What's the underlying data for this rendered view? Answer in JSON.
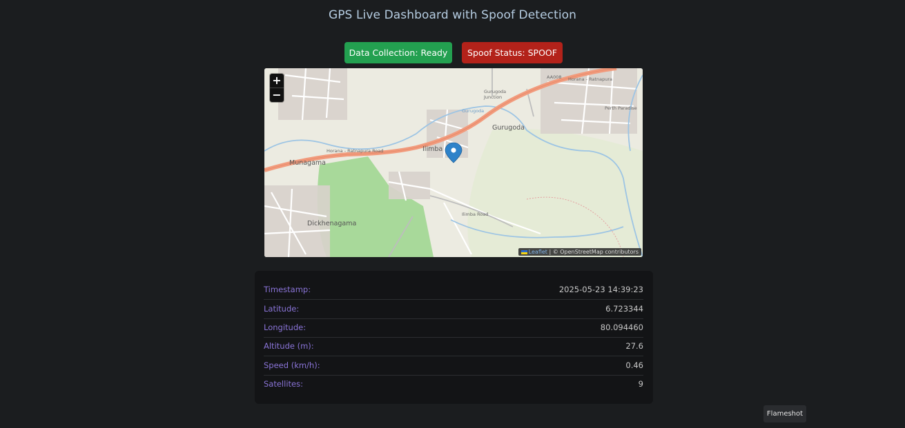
{
  "header": {
    "title": "GPS Live Dashboard with Spoof Detection"
  },
  "buttons": {
    "collection": "Data Collection: Ready",
    "spoof": "Spoof Status: SPOOF"
  },
  "map": {
    "zoom_in": "+",
    "zoom_out": "−",
    "attribution_leaflet": "Leaflet",
    "attribution_rest": "| © OpenStreetMap contributors",
    "labels": {
      "munagama": "Munagama",
      "ilimba": "Ilimba",
      "gurugoda": "Gurugoda",
      "gurugoda_junction_1": "Gurugoda",
      "gurugoda_junction_2": "Junction",
      "dickhenagama": "Dickhenagama",
      "horana_road_east": "Horana - Ratnapura",
      "horana_road_west": "Horana - Ratnapura Road",
      "aa008": "AA008",
      "ilimba_road": "Ilimba Road",
      "perth_paradise": "Perth Paradise",
      "gurugoda_river": "Gurugoda"
    },
    "colors": {
      "main_road": "#f19b7d",
      "marker": "#2e82c9",
      "park": "#a8d99a"
    }
  },
  "telemetry": {
    "timestamp_label": "Timestamp:",
    "timestamp_value": "2025-05-23 14:39:23",
    "latitude_label": "Latitude:",
    "latitude_value": "6.723344",
    "longitude_label": "Longitude:",
    "longitude_value": "80.094460",
    "altitude_label": "Altitude (m):",
    "altitude_value": "27.6",
    "speed_label": "Speed (km/h):",
    "speed_value": "0.46",
    "satellites_label": "Satellites:",
    "satellites_value": "9"
  },
  "overlay": {
    "flameshot": "Flameshot"
  },
  "colors": {
    "collection_ready": "#23a050",
    "spoof_alert": "#b3221a",
    "label_purple": "#8a74d8"
  }
}
